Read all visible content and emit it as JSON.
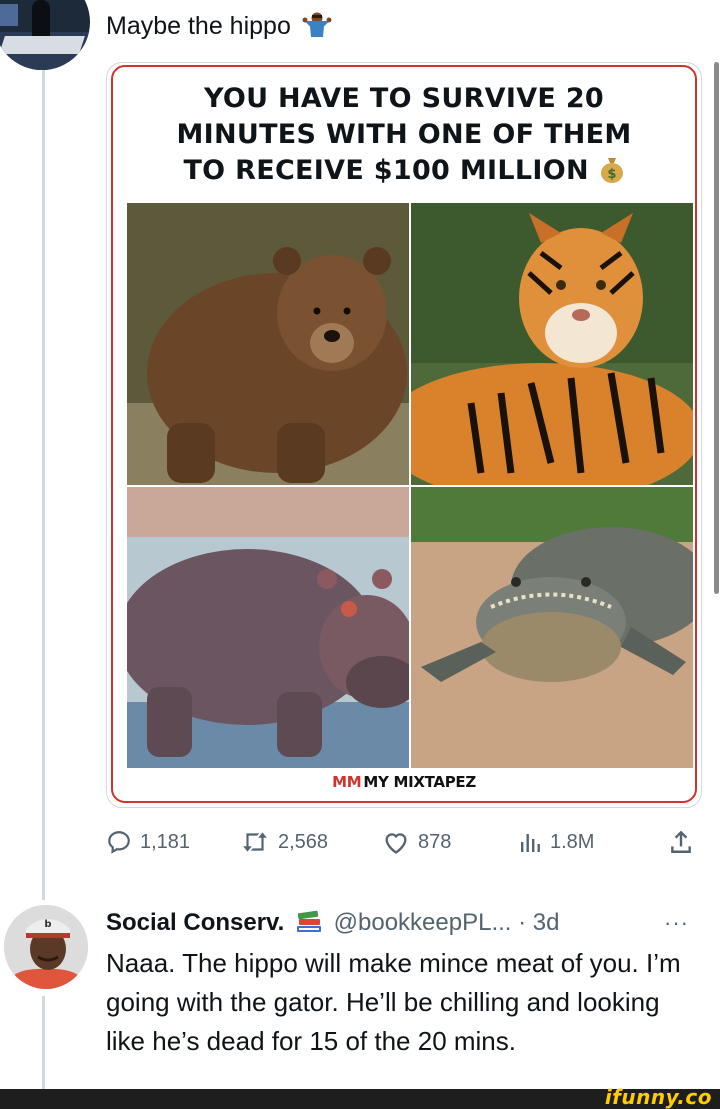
{
  "post": {
    "text": "Maybe the hippo",
    "emoji": "person-shrugging-emoji",
    "meme": {
      "headline_lines": [
        "YOU HAVE TO SURVIVE 20",
        "MINUTES WITH ONE OF THEM",
        "TO RECEIVE $100 MILLION"
      ],
      "panels": [
        "bear",
        "tiger",
        "hippo",
        "alligator"
      ],
      "watermark_mark": "MM",
      "watermark_text": "MY MIXTAPEZ"
    },
    "stats": {
      "replies": "1,181",
      "reposts": "2,568",
      "likes": "878",
      "views": "1.8M"
    }
  },
  "reply": {
    "name": "Social Conserv.",
    "badge": "books-emoji",
    "handle": "@bookkeepPL...",
    "separator": "·",
    "time": "3d",
    "more": "···",
    "text": "Naaa. The hippo will make mince meat of you. I’m going with the gator. He’ll be chilling and looking like he’s dead for 15 of the 20 mins."
  },
  "footer": {
    "brand": "ifunny.co"
  },
  "colors": {
    "accent_red": "#d0342c",
    "muted": "#536471",
    "brand_yellow": "#ffcc00"
  }
}
